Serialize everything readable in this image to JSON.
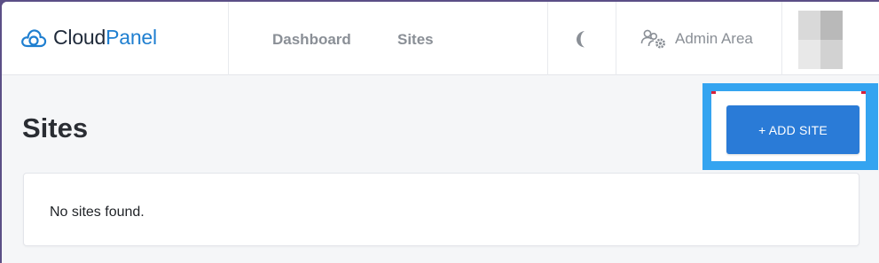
{
  "app": {
    "brand_prefix": "Cloud",
    "brand_suffix": "Panel"
  },
  "nav": {
    "items": [
      {
        "label": "Dashboard"
      },
      {
        "label": "Sites"
      }
    ]
  },
  "header": {
    "theme_icon": "moon-icon",
    "admin_icon": "users-gear-icon",
    "admin_label": "Admin Area"
  },
  "page": {
    "title": "Sites",
    "add_button_label": "+ ADD SITE",
    "empty_message": "No sites found."
  },
  "colors": {
    "accent": "#2a7bd7",
    "highlight": "#34a4f0",
    "brand_blue": "#1f7fd0"
  }
}
